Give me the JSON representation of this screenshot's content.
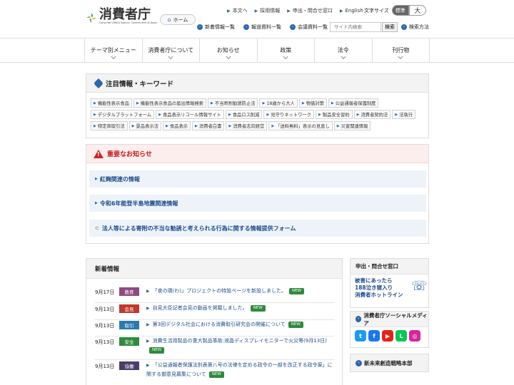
{
  "brand": {
    "name_jp": "消費者庁",
    "name_en": "Consumer Affairs Agency, Government of Japan",
    "accent": "#2c67b1"
  },
  "header": {
    "home_label": "ホーム",
    "top_links": [
      "本文へ",
      "採用情報",
      "申出・問合せ窓口",
      "English"
    ],
    "fontsize_label": "文字サイズ",
    "fontsize_standard": "標準",
    "fontsize_large": "大",
    "sub_links": [
      "新着情報一覧",
      "報道資料一覧",
      "会議資料一覧"
    ],
    "search_placeholder": "サイト内検索",
    "search_button": "検索",
    "search_help": "検索方法"
  },
  "gnav": [
    "テーマ別メニュー",
    "消費者庁について",
    "お知らせ",
    "政策",
    "法令",
    "刊行物"
  ],
  "keywords": {
    "title": "注目情報・キーワード",
    "items": [
      "機能性表示食品",
      "機能性表示食品の届出情報検索",
      "不当寄附勧誘防止法",
      "18歳から大人",
      "物価対策",
      "公益通報者保護制度",
      "デジタルプラットフォーム",
      "食品表示リコール情報サイト",
      "食品ロス削減",
      "見守りネットワーク",
      "製品安全習約",
      "消費者契約法",
      "法執行",
      "特定商取引法",
      "景品表示法",
      "食品表示",
      "消費者白書",
      "消費者志向経営",
      "「送料無料」表示の見直し",
      "災害関連情報"
    ]
  },
  "important": {
    "title": "重要なお知らせ",
    "items": [
      "紅麹関連の情報",
      "令和6年能登半島地震関連情報",
      "法人等による寄附の不当な勧誘と考えられる行為に関する情報提供フォーム"
    ]
  },
  "news": {
    "title": "新着情報",
    "new_label": "NEW",
    "items": [
      {
        "date": "9月17日",
        "category": "教育",
        "color": "#8e4a80",
        "text": "「食の環(わ)」プロジェクトの特設ページを新設しました。"
      },
      {
        "date": "9月13日",
        "category": "会見",
        "color": "#c0392b",
        "text": "自見大臣記者会見の動画を掲載しました。"
      },
      {
        "date": "9月13日",
        "category": "取引",
        "color": "#2a7ab0",
        "text": "第3回デジタル社会における消費取引研究会の開催について"
      },
      {
        "date": "9月13日",
        "category": "安全",
        "color": "#2e8b3d",
        "text": "消費生活用製品の重大製品事故:液晶ディスプレイモニターで火災等(9月13日)"
      },
      {
        "date": "9月13日",
        "category": "協働",
        "color": "#4a3d6b",
        "text": "「公益通報者保護法別表第八号の法律を定める政令の一部を改正する政令案」に関する御意見募集について"
      }
    ]
  },
  "side": {
    "contact_title": "申出・問合せ窓口",
    "hotline_lines": [
      "被害にあったら",
      "188泣き寝入り",
      "消費者ホットライン"
    ],
    "sns_title": "消費者庁ソーシャルメディア",
    "sns": [
      {
        "name": "twitter-icon",
        "glyph": "t",
        "color": "#1d9bf0"
      },
      {
        "name": "facebook-icon",
        "glyph": "f",
        "color": "#1877f2"
      },
      {
        "name": "youtube-icon",
        "glyph": "▶",
        "color": "#e62117"
      },
      {
        "name": "line-icon",
        "glyph": "L",
        "color": "#06c755"
      },
      {
        "name": "instagram-icon",
        "glyph": "◎",
        "color": "#d6249f"
      }
    ],
    "strategy_title": "新未来創造戦略本部"
  }
}
